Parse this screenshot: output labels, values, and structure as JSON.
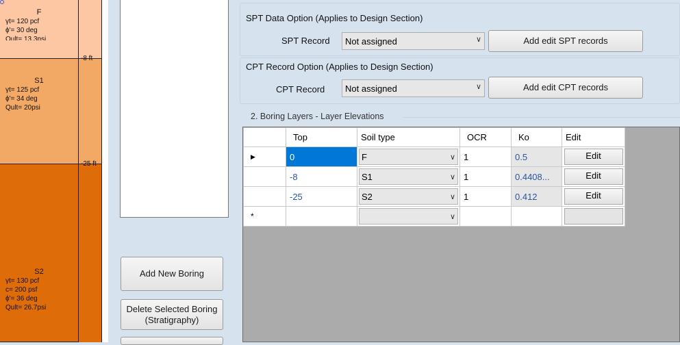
{
  "profile": {
    "layers": [
      {
        "name": "F",
        "lines": [
          "γt= 120 pcf",
          "ϕ'= 30 deg",
          "Qult= 13.3psi"
        ],
        "color": "#fdc7a4"
      },
      {
        "name": "S1",
        "lines": [
          "γt= 125 pcf",
          "ϕ'= 34 deg",
          "Qult= 20psi"
        ],
        "color": "#f3a966"
      },
      {
        "name": "S2",
        "lines": [
          "γt= 130 pcf",
          "c= 200 psf",
          "ϕ'= 36 deg",
          "Qult= 26.7psi"
        ],
        "color": "#de6d09"
      }
    ],
    "depths": [
      "-8 ft",
      "-25 ft"
    ]
  },
  "left_buttons": {
    "add_new": "Add New Boring",
    "delete_selected": "Delete Selected Boring (Stratigraphy)"
  },
  "spt": {
    "group_title": "SPT Data Option (Applies to Design Section)",
    "record_label": "SPT Record",
    "record_value": "Not assigned",
    "button": "Add edit SPT records"
  },
  "cpt": {
    "group_title": "CPT Record Option (Applies to Design Section)",
    "record_label": "CPT Record",
    "record_value": "Not assigned",
    "button": "Add edit CPT records"
  },
  "layers_section": {
    "title": "2. Boring Layers - Layer Elevations",
    "columns": [
      "Top",
      "Soil type",
      "OCR",
      "Ko",
      "Edit"
    ],
    "rows": [
      {
        "marker": "▶",
        "top": "0",
        "soil": "F",
        "ocr": "1",
        "ko": "0.5",
        "edit": "Edit"
      },
      {
        "marker": "",
        "top": "-8",
        "soil": "S1",
        "ocr": "1",
        "ko": "0.4408...",
        "edit": "Edit"
      },
      {
        "marker": "",
        "top": "-25",
        "soil": "S2",
        "ocr": "1",
        "ko": "0.412",
        "edit": "Edit"
      }
    ],
    "new_row_marker": "*"
  },
  "icons": {
    "chevron": "chevron-down-icon",
    "row_pointer": "row-pointer-icon"
  }
}
